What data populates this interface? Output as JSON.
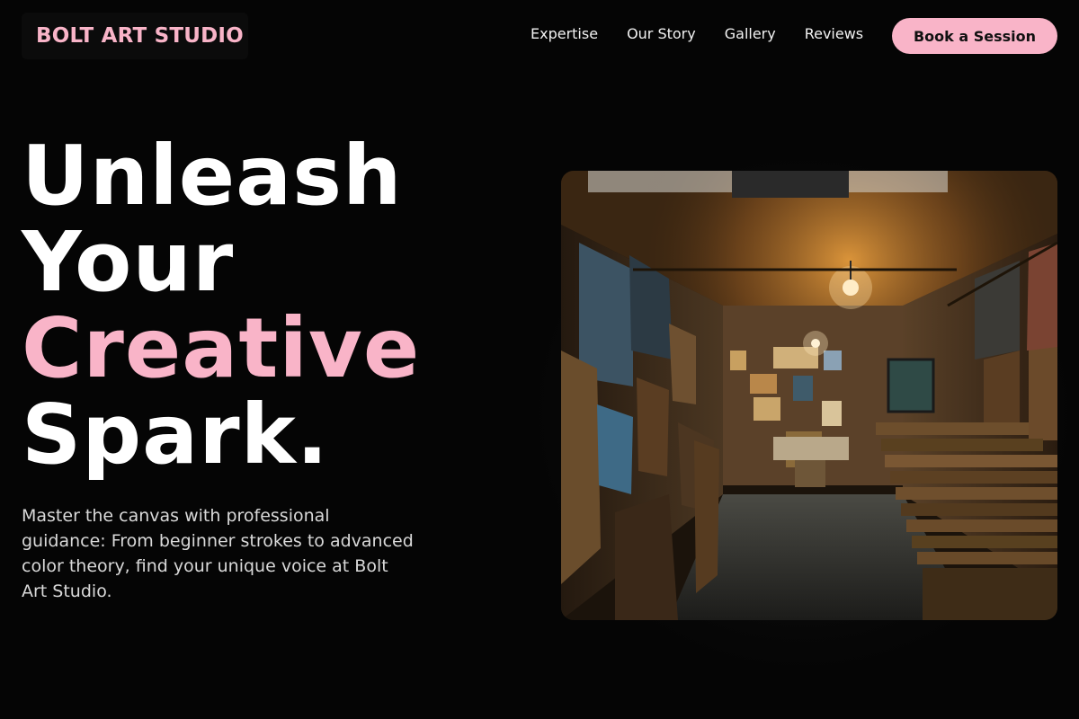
{
  "header": {
    "logo": "BOLT ART STUDIO",
    "nav": [
      "Expertise",
      "Our Story",
      "Gallery",
      "Reviews"
    ],
    "cta": "Book a Session"
  },
  "hero": {
    "title_lines": [
      "Unleash",
      "Your"
    ],
    "title_accent": "Creative",
    "title_last": "Spark.",
    "description": "Master the canvas with professional guidance: From beginner strokes to advanced color theory, find your unique voice at Bolt Art Studio."
  },
  "image": {
    "subject": "art-gallery-corridor-photo"
  },
  "colors": {
    "background": "#050505",
    "accent": "#f9b4c8",
    "text": "#ffffff",
    "muted_text": "#d9d9d9"
  }
}
